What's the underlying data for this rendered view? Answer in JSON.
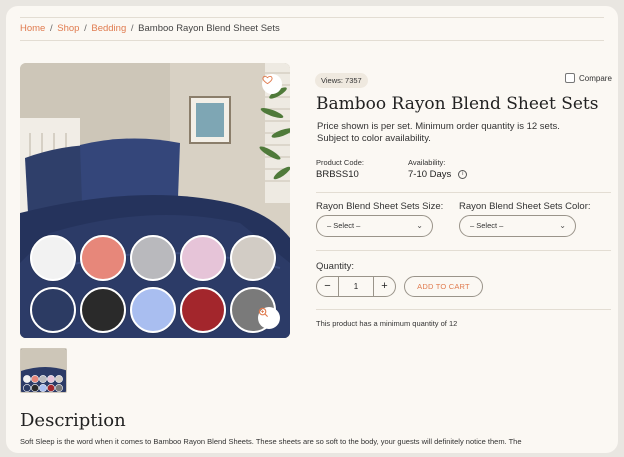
{
  "breadcrumb": {
    "home": "Home",
    "shop": "Shop",
    "bedding": "Bedding",
    "current": "Bamboo Rayon Blend Sheet Sets",
    "separator": "/"
  },
  "product": {
    "views": "Views: 7357",
    "compare_label": "Compare",
    "title": "Bamboo Rayon Blend Sheet Sets",
    "price_note": "Price shown is per set. Minimum order quantity is 12 sets. Subject to color availability.",
    "code_label": "Product Code:",
    "code_value": "BRBSS10",
    "availability_label": "Availability:",
    "availability_value": "7-10 Days",
    "size_label": "Rayon Blend Sheet Sets Size:",
    "size_placeholder": "– Select –",
    "color_label": "Rayon Blend Sheet Sets Color:",
    "color_placeholder": "– Select –",
    "quantity_label": "Quantity:",
    "quantity_value": "1",
    "minus": "−",
    "plus": "+",
    "add_to_cart": "ADD TO CART",
    "min_note": "This product has a minimum quantity of 12"
  },
  "swatches": [
    {
      "name": "white",
      "color": "#f2f2f2"
    },
    {
      "name": "coral",
      "color": "#e7877a"
    },
    {
      "name": "silver",
      "color": "#b9b9bd"
    },
    {
      "name": "pink",
      "color": "#e6c4d8"
    },
    {
      "name": "taupe",
      "color": "#d2ccc5"
    },
    {
      "name": "navy",
      "color": "#2c3b63"
    },
    {
      "name": "black",
      "color": "#2a2a2a"
    },
    {
      "name": "light-blue",
      "color": "#a9bef0"
    },
    {
      "name": "burgundy",
      "color": "#a3262c"
    },
    {
      "name": "gray",
      "color": "#7a7a7a"
    }
  ],
  "icons": {
    "heart": "heart-icon",
    "zoom": "zoom-in-icon",
    "info": "info-icon"
  },
  "description": {
    "heading": "Description",
    "text": "Soft Sleep is the word when it comes to Bamboo Rayon Blend Sheets. These sheets are so soft to the body, your guests will definitely notice them. The"
  },
  "colors": {
    "accent": "#e07b4f",
    "background": "#fbf8f3"
  }
}
